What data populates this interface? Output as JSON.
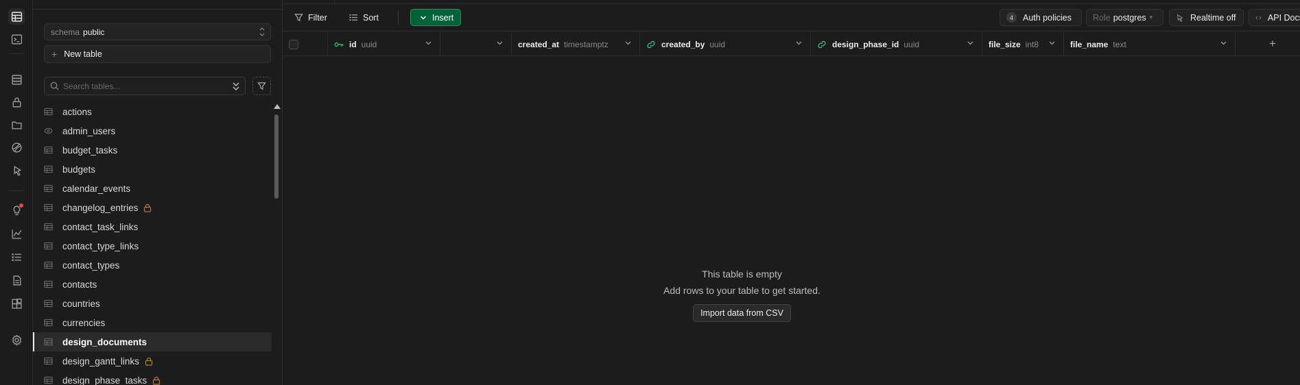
{
  "rail": {
    "icons": [
      "table-editor-icon",
      "sql-editor-icon",
      "database-icon",
      "auth-icon",
      "storage-icon",
      "realtime-icon",
      "edge-functions-icon",
      "advisors-icon",
      "reports-icon",
      "logs-icon",
      "api-docs-icon",
      "integrations-icon",
      "settings-icon"
    ]
  },
  "sidebar": {
    "schema_label": "schema",
    "schema_value": "public",
    "new_table_label": "New table",
    "search_placeholder": "Search tables...",
    "tables": [
      {
        "name": "actions",
        "icon": "table-icon",
        "locked": false
      },
      {
        "name": "admin_users",
        "icon": "view-icon",
        "locked": false
      },
      {
        "name": "budget_tasks",
        "icon": "table-icon",
        "locked": false
      },
      {
        "name": "budgets",
        "icon": "table-icon",
        "locked": false
      },
      {
        "name": "calendar_events",
        "icon": "table-icon",
        "locked": false
      },
      {
        "name": "changelog_entries",
        "icon": "table-icon",
        "locked": true
      },
      {
        "name": "contact_task_links",
        "icon": "table-icon",
        "locked": false
      },
      {
        "name": "contact_type_links",
        "icon": "table-icon",
        "locked": false
      },
      {
        "name": "contact_types",
        "icon": "table-icon",
        "locked": false
      },
      {
        "name": "contacts",
        "icon": "table-icon",
        "locked": false
      },
      {
        "name": "countries",
        "icon": "table-icon",
        "locked": false
      },
      {
        "name": "currencies",
        "icon": "table-icon",
        "locked": false
      },
      {
        "name": "design_documents",
        "icon": "table-icon",
        "locked": false,
        "active": true
      },
      {
        "name": "design_gantt_links",
        "icon": "table-icon",
        "locked": true
      },
      {
        "name": "design_phase_tasks",
        "icon": "table-icon",
        "locked": true
      }
    ]
  },
  "toolbar": {
    "filter_label": "Filter",
    "sort_label": "Sort",
    "insert_label": "Insert",
    "auth_policies_count": "4",
    "auth_policies_label": "Auth policies",
    "role_label": "Role",
    "role_value": "postgres",
    "realtime_label": "Realtime off",
    "api_docs_label": "API Docs"
  },
  "columns": [
    {
      "name": "id",
      "type": "uuid",
      "icon": "key-icon"
    },
    {
      "name": "",
      "type": "",
      "icon": ""
    },
    {
      "name": "created_at",
      "type": "timestamptz",
      "icon": ""
    },
    {
      "name": "created_by",
      "type": "uuid",
      "icon": "link-icon"
    },
    {
      "name": "design_phase_id",
      "type": "uuid",
      "icon": "link-icon"
    },
    {
      "name": "file_size",
      "type": "int8",
      "icon": ""
    },
    {
      "name": "file_name",
      "type": "text",
      "icon": ""
    }
  ],
  "empty_state": {
    "title": "This table is empty",
    "subtitle": "Add rows to your table to get started.",
    "import_button": "Import data from CSV"
  },
  "colors": {
    "accent_green": "#3ecf8e",
    "insert_bg": "#006239",
    "background": "#1c1c1c",
    "lock_color": "#b07a3a",
    "notification_red": "#e5484d"
  }
}
